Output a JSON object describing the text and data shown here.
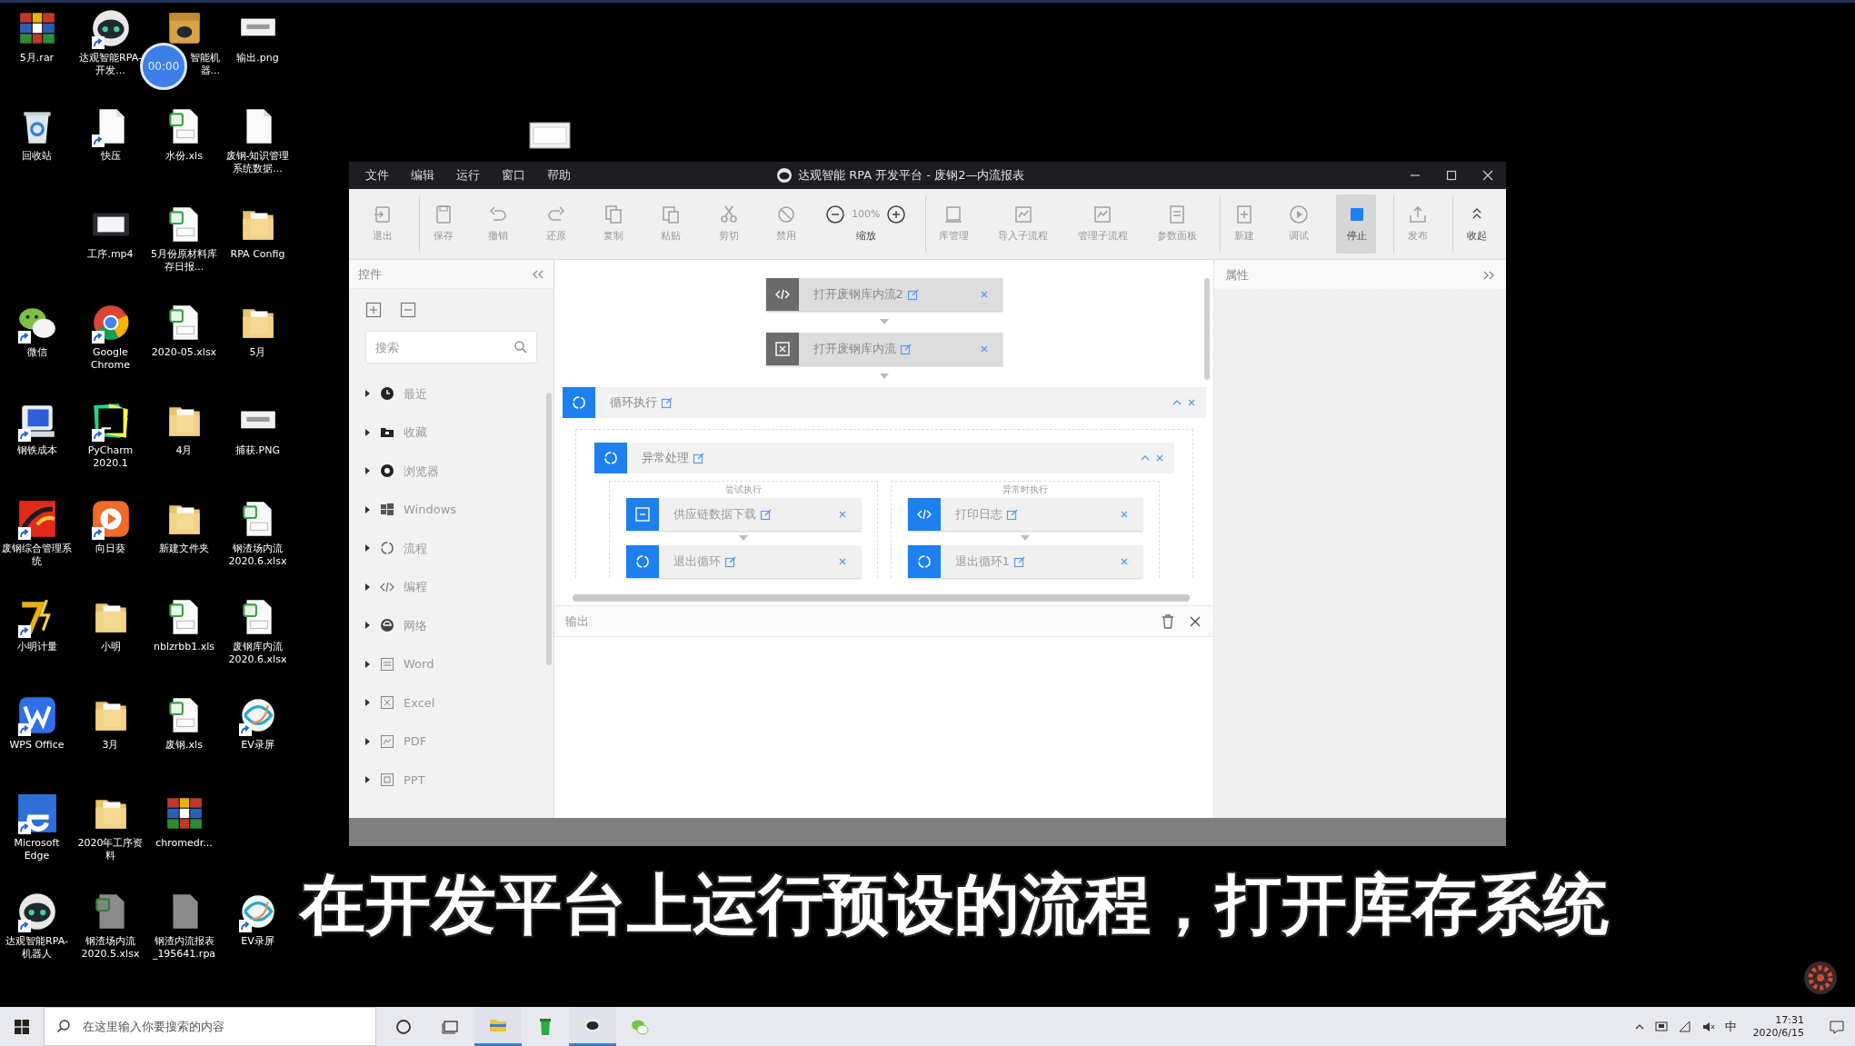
{
  "desktop": {
    "rows": [
      {
        "icons": [
          {
            "label": "5月.rar",
            "kind": "archive",
            "shortcut": false
          },
          {
            "label": "达观智能RPA-开发...",
            "kind": "robot",
            "shortcut": true
          },
          {
            "label": "智能机器...",
            "kind": "box",
            "shortcut": false,
            "covered": true
          },
          {
            "label": "输出.png",
            "kind": "image",
            "shortcut": false
          }
        ]
      },
      {
        "icons": [
          {
            "label": "回收站",
            "kind": "recycle",
            "shortcut": false
          },
          {
            "label": "快压",
            "kind": "file",
            "shortcut": true
          },
          {
            "label": "水份.xls",
            "kind": "sheet",
            "shortcut": false
          },
          {
            "label": "废钢-知识管理系统数据...",
            "kind": "file",
            "shortcut": false
          }
        ]
      },
      {
        "skip_first": true,
        "icons": [
          {
            "label": "工序.mp4",
            "kind": "video",
            "shortcut": false
          },
          {
            "label": "5月份原材料库存日报...",
            "kind": "sheet",
            "shortcut": false
          },
          {
            "label": "RPA Config",
            "kind": "folder",
            "shortcut": false
          }
        ]
      },
      {
        "icons": [
          {
            "label": "微信",
            "kind": "wechat",
            "shortcut": true
          },
          {
            "label": "Google Chrome",
            "kind": "chrome",
            "shortcut": true
          },
          {
            "label": "2020-05.xlsx",
            "kind": "sheet",
            "shortcut": false
          },
          {
            "label": "5月",
            "kind": "folder",
            "shortcut": false
          }
        ]
      },
      {
        "icons": [
          {
            "label": "钢铁成本",
            "kind": "computer",
            "shortcut": true
          },
          {
            "label": "PyCharm 2020.1",
            "kind": "pycharm",
            "shortcut": true
          },
          {
            "label": "4月",
            "kind": "folder",
            "shortcut": false
          },
          {
            "label": "捕获.PNG",
            "kind": "image",
            "shortcut": false
          }
        ]
      },
      {
        "icons": [
          {
            "label": "废钢综合管理系统",
            "kind": "redapp",
            "shortcut": true
          },
          {
            "label": "向日葵",
            "kind": "sunflower",
            "shortcut": true
          },
          {
            "label": "新建文件夹",
            "kind": "folder",
            "shortcut": false
          },
          {
            "label": "钢渣场内流 2020.6.xlsx",
            "kind": "sheet",
            "shortcut": false
          }
        ]
      },
      {
        "icons": [
          {
            "label": "小明计量",
            "kind": "seven",
            "shortcut": true
          },
          {
            "label": "小明",
            "kind": "folder",
            "shortcut": false
          },
          {
            "label": "nblzrbb1.xls",
            "kind": "sheet",
            "shortcut": false
          },
          {
            "label": "废钢库内流 2020.6.xlsx",
            "kind": "sheet",
            "shortcut": false
          }
        ]
      },
      {
        "icons": [
          {
            "label": "WPS Office",
            "kind": "wps",
            "shortcut": true
          },
          {
            "label": "3月",
            "kind": "folder",
            "shortcut": false
          },
          {
            "label": "废钢.xls",
            "kind": "sheet",
            "shortcut": false
          },
          {
            "label": "EV录屏",
            "kind": "ev",
            "shortcut": true
          }
        ]
      },
      {
        "icons": [
          {
            "label": "Microsoft Edge",
            "kind": "edge",
            "shortcut": true
          },
          {
            "label": "2020年工序资料",
            "kind": "folder",
            "shortcut": false
          },
          {
            "label": "chromedr...",
            "kind": "archive",
            "shortcut": false
          }
        ]
      },
      {
        "icons": [
          {
            "label": "达观智能RPA-机器人",
            "kind": "robot",
            "shortcut": true
          },
          {
            "label": "钢渣场内流 2020.5.xlsx",
            "kind": "greysheet",
            "shortcut": false
          },
          {
            "label": "钢渣内流报表_195641.rpa",
            "kind": "greyfile",
            "shortcut": false
          },
          {
            "label": "EV录屏",
            "kind": "ev",
            "shortcut": true
          }
        ]
      }
    ]
  },
  "recording_badge": {
    "time": "00:00"
  },
  "app_window": {
    "title": "达观智能 RPA 开发平台 - 废钢2—内流报表",
    "menu": [
      "文件",
      "编辑",
      "运行",
      "窗口",
      "帮助"
    ],
    "toolbar": [
      {
        "label": "退出",
        "kind": "exit",
        "disabled": true,
        "separator_before": false
      },
      {
        "label": "保存",
        "kind": "save",
        "disabled": true,
        "separator_before": true
      },
      {
        "label": "撤销",
        "kind": "undo",
        "disabled": true,
        "separator_before": false
      },
      {
        "label": "还原",
        "kind": "redo",
        "disabled": true,
        "separator_before": false
      },
      {
        "label": "复制",
        "kind": "copy",
        "disabled": true,
        "separator_before": false
      },
      {
        "label": "粘贴",
        "kind": "paste",
        "disabled": true,
        "separator_before": false
      },
      {
        "label": "剪切",
        "kind": "cut",
        "disabled": true,
        "separator_before": false
      },
      {
        "label": "禁用",
        "kind": "disable",
        "disabled": true,
        "separator_before": false
      },
      {
        "label": "缩放",
        "kind": "zoom",
        "value": "100%",
        "disabled": false
      },
      {
        "label": "库管理",
        "kind": "library",
        "disabled": true,
        "separator_before": true
      },
      {
        "label": "导入子流程",
        "kind": "import",
        "disabled": true,
        "separator_before": false
      },
      {
        "label": "管理子流程",
        "kind": "manage",
        "disabled": true,
        "separator_before": false
      },
      {
        "label": "参数面板",
        "kind": "params",
        "disabled": true,
        "separator_before": false
      },
      {
        "label": "新建",
        "kind": "new",
        "disabled": true,
        "separator_before": true
      },
      {
        "label": "调试",
        "kind": "debug",
        "disabled": true,
        "separator_before": false
      },
      {
        "label": "停止",
        "kind": "stop",
        "disabled": false,
        "highlighted": true,
        "separator_before": false
      },
      {
        "label": "发布",
        "kind": "publish",
        "disabled": true,
        "separator_before": true
      },
      {
        "label": "收起",
        "kind": "collapse",
        "disabled": false,
        "separator_before": true
      }
    ],
    "controls_panel": {
      "title": "控件",
      "search_placeholder": "搜索",
      "tree": [
        {
          "label": "最近",
          "kind": "recent",
          "expanded": false
        },
        {
          "label": "收藏",
          "kind": "favorites",
          "expanded": false
        },
        {
          "label": "浏览器",
          "kind": "browser",
          "expanded": false
        },
        {
          "label": "Windows",
          "kind": "windows",
          "expanded": false
        },
        {
          "label": "流程",
          "kind": "flow",
          "expanded": false
        },
        {
          "label": "编程",
          "kind": "code",
          "expanded": false
        },
        {
          "label": "网络",
          "kind": "network",
          "expanded": false
        },
        {
          "label": "Word",
          "kind": "word",
          "expanded": false
        },
        {
          "label": "Excel",
          "kind": "excel",
          "expanded": false
        },
        {
          "label": "PDF",
          "kind": "pdf",
          "expanded": false
        },
        {
          "label": "PPT",
          "kind": "ppt",
          "expanded": false
        }
      ]
    },
    "canvas": {
      "steps": [
        {
          "label": "打开废钢库内流2",
          "kind": "code",
          "disabled": true
        },
        {
          "label": "打开废钢库内流",
          "kind": "excel",
          "disabled": true
        }
      ],
      "loop": {
        "label": "循环执行",
        "expanded": true,
        "block": {
          "label": "异常处理",
          "expanded": true,
          "branches": [
            {
              "title": "尝试执行",
              "steps": [
                {
                  "label": "供应链数据下载",
                  "kind": "module",
                  "disabled": false
                },
                {
                  "label": "退出循环",
                  "kind": "flow",
                  "disabled": false
                }
              ]
            },
            {
              "title": "异常时执行",
              "steps": [
                {
                  "label": "打印日志",
                  "kind": "code",
                  "disabled": false
                },
                {
                  "label": "退出循环1",
                  "kind": "flow",
                  "disabled": false
                }
              ]
            }
          ]
        }
      }
    },
    "output_panel": {
      "title": "输出"
    },
    "properties_panel": {
      "title": "属性"
    }
  },
  "subtitle": "在开发平台上运行预设的流程，打开库存系统",
  "taskbar": {
    "search_placeholder": "在这里输入你要搜索的内容",
    "apps": [
      {
        "kind": "cortana",
        "active": false
      },
      {
        "kind": "taskview",
        "active": false
      },
      {
        "kind": "explorer",
        "active": true
      },
      {
        "kind": "greenapp",
        "active": false
      },
      {
        "kind": "robot",
        "active": true
      },
      {
        "kind": "wechat",
        "active": false
      }
    ],
    "ime": "中",
    "time": "17:31",
    "date": "2020/6/15"
  }
}
